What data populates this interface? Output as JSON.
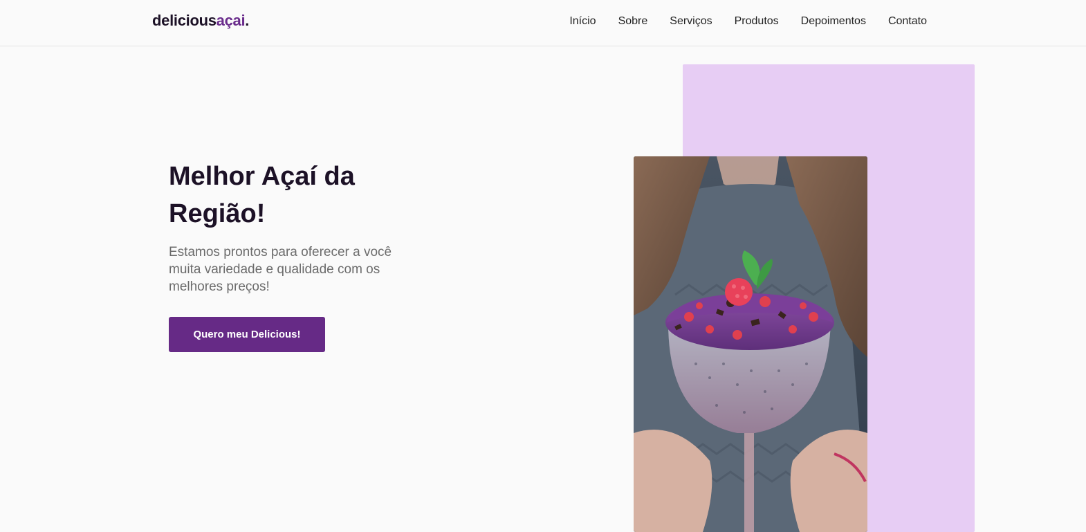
{
  "header": {
    "logo_main": "delicious",
    "logo_accent": "açai",
    "logo_dot": ".",
    "nav": [
      {
        "label": "Início"
      },
      {
        "label": "Sobre"
      },
      {
        "label": "Serviços"
      },
      {
        "label": "Produtos"
      },
      {
        "label": "Depoimentos"
      },
      {
        "label": "Contato"
      }
    ]
  },
  "hero": {
    "title": "Melhor Açaí da Região!",
    "subtitle": "Estamos prontos para oferecer a você muita variedade e qualidade com os melhores preços!",
    "cta_label": "Quero meu Delicious!"
  },
  "colors": {
    "accent": "#662a86",
    "lilac": "#e7cdf4",
    "text_dark": "#1c1126"
  }
}
